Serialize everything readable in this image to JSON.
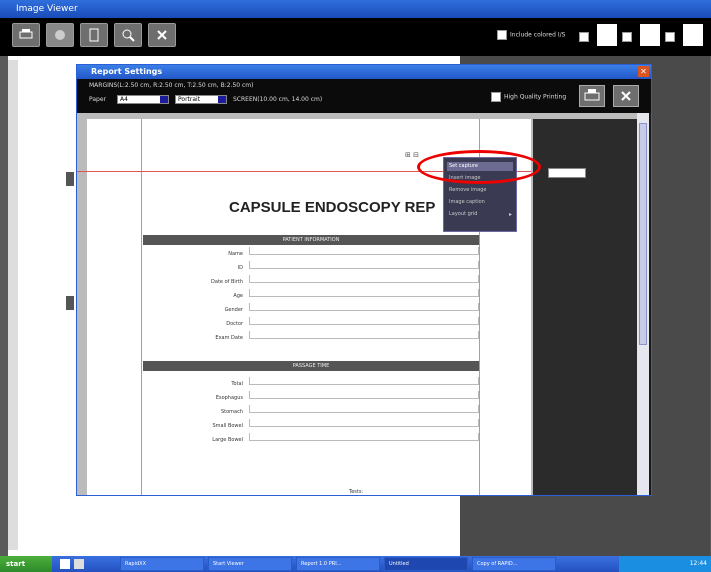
{
  "outer_window": {
    "title": "Image Viewer",
    "include_colored_label": "Include colored I/S"
  },
  "dialog": {
    "title": "Report Settings",
    "margins_line1": "MARGINS(L:2.50 cm, R:2.50 cm, T:2.50 cm, B:2.50 cm)",
    "paper_label": "Paper",
    "paper_value": "A4",
    "orientation_value": "Portrait",
    "margins_line2": "SCREEN(10.00 cm, 14.00 cm)",
    "hq_label": "High Quality Printing"
  },
  "report": {
    "title": "CAPSULE ENDOSCOPY REP",
    "section1_title": "PATIENT INFORMATION",
    "section1_fields": [
      "Name",
      "ID",
      "Date of Birth",
      "Age",
      "Gender",
      "Doctor",
      "Exam Date"
    ],
    "section2_title": "PASSAGE TIME",
    "section2_fields": [
      "Total",
      "Esophagus",
      "Stomach",
      "Small Bowel",
      "Large Bowel"
    ],
    "footer_text": "Tests:"
  },
  "context_menu": {
    "items": [
      "Set capture",
      "Insert image",
      "Remove image",
      "Image caption",
      "Layout grid"
    ]
  },
  "taskbar": {
    "start_label": "start",
    "tasks": [
      "RapidXX",
      "Start Viewer",
      "Report 1.0 PRI...",
      "Untitled",
      "Copy of RAPID..."
    ],
    "tray_time": "12:44"
  }
}
